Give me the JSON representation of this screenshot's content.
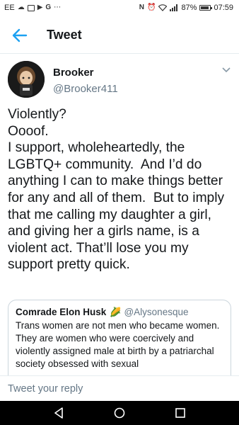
{
  "status_bar": {
    "carrier": "EE",
    "battery_percent": "87%",
    "time": "07:59",
    "icons": [
      "cloud-icon",
      "image-icon",
      "video-icon",
      "google-icon",
      "more-icon",
      "nfc-icon",
      "alarm-icon",
      "wifi-icon",
      "signal-icon",
      "battery-icon"
    ]
  },
  "header": {
    "title": "Tweet",
    "back_icon": "arrow-left-icon"
  },
  "tweet": {
    "author_name": "Brooker",
    "author_handle": "@Brooker411",
    "text": "Violently?\nOooof.\nI support, wholeheartedly, the LGBTQ+ community.  And I’d do anything I can to make things better for any and all of them.  But to imply that me calling my daughter a girl, and giving her a girls name, is a violent act. That’ll lose you my support pretty quick."
  },
  "quoted_tweet": {
    "author_name": "Comrade Elon Husk",
    "emoji": "🌽",
    "author_handle": "@Alysonesque",
    "text": "Trans women are not men who became women. They are women who were coercively and violently assigned male at birth by a patriarchal society obsessed with sexual"
  },
  "reply": {
    "placeholder": "Tweet your reply"
  },
  "colors": {
    "accent": "#1da1f2",
    "text": "#14171a",
    "secondary_text": "#657786",
    "border": "#ccd6dd"
  }
}
